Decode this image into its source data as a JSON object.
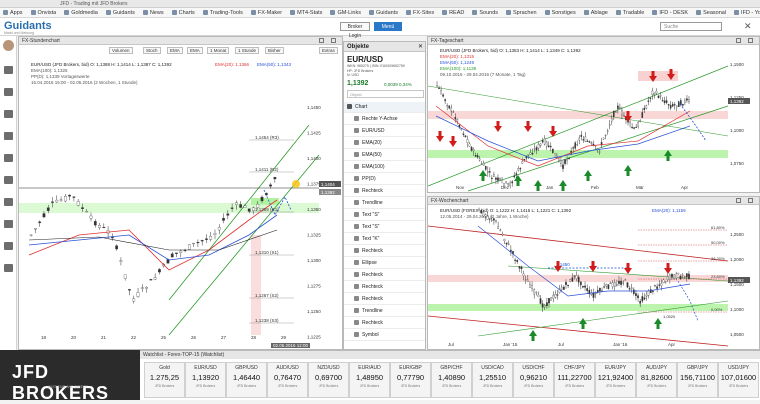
{
  "browser": {
    "tab_text": "JFD - Trading mit JFD Brokers",
    "bookmarks": [
      "Apps",
      "Onvista",
      "Goldmedia",
      "Guidants",
      "News",
      "Charts",
      "Trading-Tools",
      "FX-Maker",
      "MT4-Stats",
      "GM-Links",
      "Guidants",
      "FX-Sites",
      "READ",
      "Sounds",
      "Sprachen",
      "Sonstiges",
      "Ablage",
      "Tradable",
      "IFD - DESK",
      "Seasonal",
      "IFD - YouTube",
      "Medien - mywebinar"
    ]
  },
  "header": {
    "logo": "Guidants",
    "logo_sub": "Markt und Meinung",
    "login_button": "Broker Login",
    "menu_button": "Menü",
    "search_placeholder": "Suche"
  },
  "hourly_chart": {
    "title": "FX-Stundenchart",
    "toolbar": [
      "Volumen",
      "Stoch",
      "EMA",
      "EMA",
      "1 Monat",
      "1 Stunde",
      "Bisher",
      "Extras"
    ],
    "info_line1": "EUR/USD (JFD Brokers, bid)  O: 1,1388  H: 1,1414  L: 1,1387  C: 1,1392",
    "info_ema20": "EMA(20): 1,1366",
    "info_ema50": "EMA(50): 1,1343",
    "info_line2": "EMA(100): 1,1325",
    "info_line3": "PP(D): 1,1339  Vortageswerte",
    "info_line4": "15.04.2016 15:00 - 02.05.2016 (2 Wochen, 1 Stunde)",
    "y_ticks": [
      "1,1450",
      "1,1425",
      "1,1400",
      "1,1375",
      "1,1350",
      "1,1325",
      "1,1300",
      "1,1275",
      "1,1250",
      "1,1225"
    ],
    "x_ticks": [
      "18",
      "20",
      "21",
      "22",
      "25",
      "26",
      "27",
      "28",
      "29"
    ],
    "level_labels": [
      "1,1454 (R3)",
      "1,1411 (R2)",
      "1,1369 (R1)",
      "1,1310 (S1)",
      "1,1267 (S2)",
      "1,1238 (S3)"
    ],
    "price_tags": [
      "1,1404",
      "1,1392"
    ],
    "footer": "02.05.2016 12:00"
  },
  "objects": {
    "header": "Objekte",
    "pair": "EUR/USD",
    "sub": "WKN: 965275 | ISIN: EU0009652759\nHP: JFD Brokers\nN: USD",
    "price": "1,1392",
    "change": "0,0039  0,34%",
    "filter_placeholder": "Objekt",
    "items": [
      "Chart",
      "Rechte Y-Achse",
      "EUR/USD",
      "EMA(20)",
      "EMA(50)",
      "EMA(100)",
      "PP(D)",
      "Rechteck",
      "Trendline",
      "Text \"S\"",
      "Text \"S\"",
      "Text \"K\"",
      "Rechteck",
      "Ellipse",
      "Rechteck",
      "Rechteck",
      "Rechteck",
      "Trendline",
      "Rechteck",
      "Symbol"
    ]
  },
  "daily_chart": {
    "title": "FX-Tageschart",
    "info_line1": "EUR/USD (JFD Brokers, bid)  O: 1,1353  H: 1,1414  L: 1,1349  C: 1,1392",
    "info_line2": "EMA(20): 1,1315",
    "info_line3": "EMA(50): 1,1249",
    "info_line4": "EMA(100): 1,1138",
    "info_line5": "09.10.2015 - 29.04.2016 (7 Monate, 1 Tag)",
    "y_ticks": [
      "1,1500",
      "1,1250",
      "1,1000",
      "1,0750"
    ],
    "x_ticks": [
      "Nov",
      "Dez",
      "Jan",
      "Feb",
      "Mär",
      "Apr"
    ],
    "price_tags": [
      "1,1392"
    ]
  },
  "weekly_chart": {
    "title": "FX-Wochenchart",
    "info_line1": "EUR/USD (FOREX, bid)  O: 1,1222  H: 1,1415  L: 1,1221  C: 1,1392",
    "info_ema": "EMA(20): 1,1159",
    "info_line2": "12.05.2014 - 29.04.2016 (2 Jahre, 1 Woche)",
    "y_ticks": [
      "1,2500",
      "1,2000",
      "1,1500",
      "1,1000",
      "1,0500"
    ],
    "x_ticks": [
      "Jul",
      "Jan '15",
      "Jul",
      "Jan '16",
      "Apr"
    ],
    "fib_labels": [
      "61,80%",
      "50,00%",
      "38,20%",
      "23,60%",
      "0,00%"
    ],
    "annotations": [
      "1,1450",
      "1,0520"
    ],
    "price_tags": [
      "1,1392"
    ]
  },
  "watchlist": {
    "title": "Watchlist - Forex-TOP-15 (Watchlist)",
    "tiles": [
      {
        "name": "Gold",
        "value": "1.275,25"
      },
      {
        "name": "EUR/USD",
        "value": "1,13920"
      },
      {
        "name": "GBP/USD",
        "value": "1,46440"
      },
      {
        "name": "AUD/USD",
        "value": "0,76470"
      },
      {
        "name": "NZD/USD",
        "value": "0,69700"
      },
      {
        "name": "EUR/AUD",
        "value": "1,48950"
      },
      {
        "name": "EUR/GBP",
        "value": "0,77790"
      },
      {
        "name": "GBP/CHF",
        "value": "1,40890"
      },
      {
        "name": "USD/CAD",
        "value": "1,25510"
      },
      {
        "name": "USD/CHF",
        "value": "0,96210"
      },
      {
        "name": "CHF/JPY",
        "value": "111,22700"
      },
      {
        "name": "EUR/JPY",
        "value": "121,92400"
      },
      {
        "name": "AUD/JPY",
        "value": "81,82600"
      },
      {
        "name": "GBP/JPY",
        "value": "156,71100"
      },
      {
        "name": "USD/JPY",
        "value": "107,01600"
      }
    ],
    "tile_footer": "JFD Brokers"
  },
  "broker_logo": {
    "text": "JFD BROKERS",
    "tagline": "JUST FAIR AND DIRECT"
  },
  "colors": {
    "accent": "#2a78c8",
    "up": "#1a8a2a",
    "down": "#d21c1c",
    "ema_red": "#e03030",
    "ema_blue": "#2a4fd6",
    "zone_green": "#9ff08a",
    "zone_pink": "#f6c6c6"
  }
}
